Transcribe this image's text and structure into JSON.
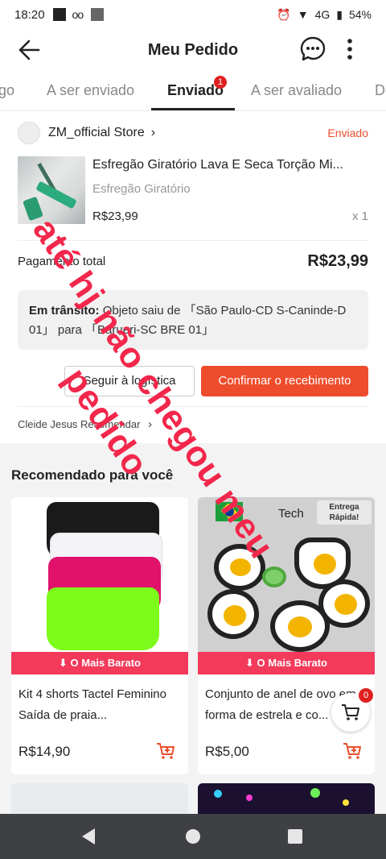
{
  "status_bar": {
    "time": "18:20",
    "battery": "54%",
    "network": "4G"
  },
  "header": {
    "title": "Meu Pedido"
  },
  "tabs": [
    {
      "label": "go"
    },
    {
      "label": "A ser enviado"
    },
    {
      "label": "Enviado",
      "badge": "1"
    },
    {
      "label": "A ser avaliado"
    },
    {
      "label": "De"
    }
  ],
  "order": {
    "store_name": "ZM_official Store",
    "status": "Enviado",
    "product_title": "Esfregão Giratório Lava E Seca Torção Mi...",
    "variant": "Esfregão Giratório",
    "price": "R$23,99",
    "quantity": "x 1",
    "total_label": "Pagamento total",
    "total_value": "R$23,99",
    "transit_label": "Em trânsito:",
    "transit_text": "Objeto saiu de 「São Paulo-CD S-Caninde-D 01」 para 「Barueri-SC BRE 01」",
    "button_track": "Seguir à logística",
    "button_confirm": "Confirmar o recebimento",
    "recommend_text": "Cleide Jesus Recomendar"
  },
  "recommendations": {
    "title": "Recomendado para você",
    "items": [
      {
        "banner": "O Mais Barato",
        "name": "Kit 4 shorts Tactel Feminino Saída de praia...",
        "price": "R$14,90"
      },
      {
        "banner": "O Mais Barato",
        "name": "Conjunto de anel de ovo em forma de estrela e co...",
        "price": "R$5,00",
        "promo_badge": "Entrega Rápida!",
        "brand": "Tech"
      }
    ]
  },
  "cart": {
    "badge": "0"
  },
  "overlay": {
    "line1": "até hj não chegou meu",
    "line2": "pedido"
  },
  "colors": {
    "accent": "#ee4d2d",
    "banner": "#f33a5a",
    "overlay": "#f2274b"
  }
}
